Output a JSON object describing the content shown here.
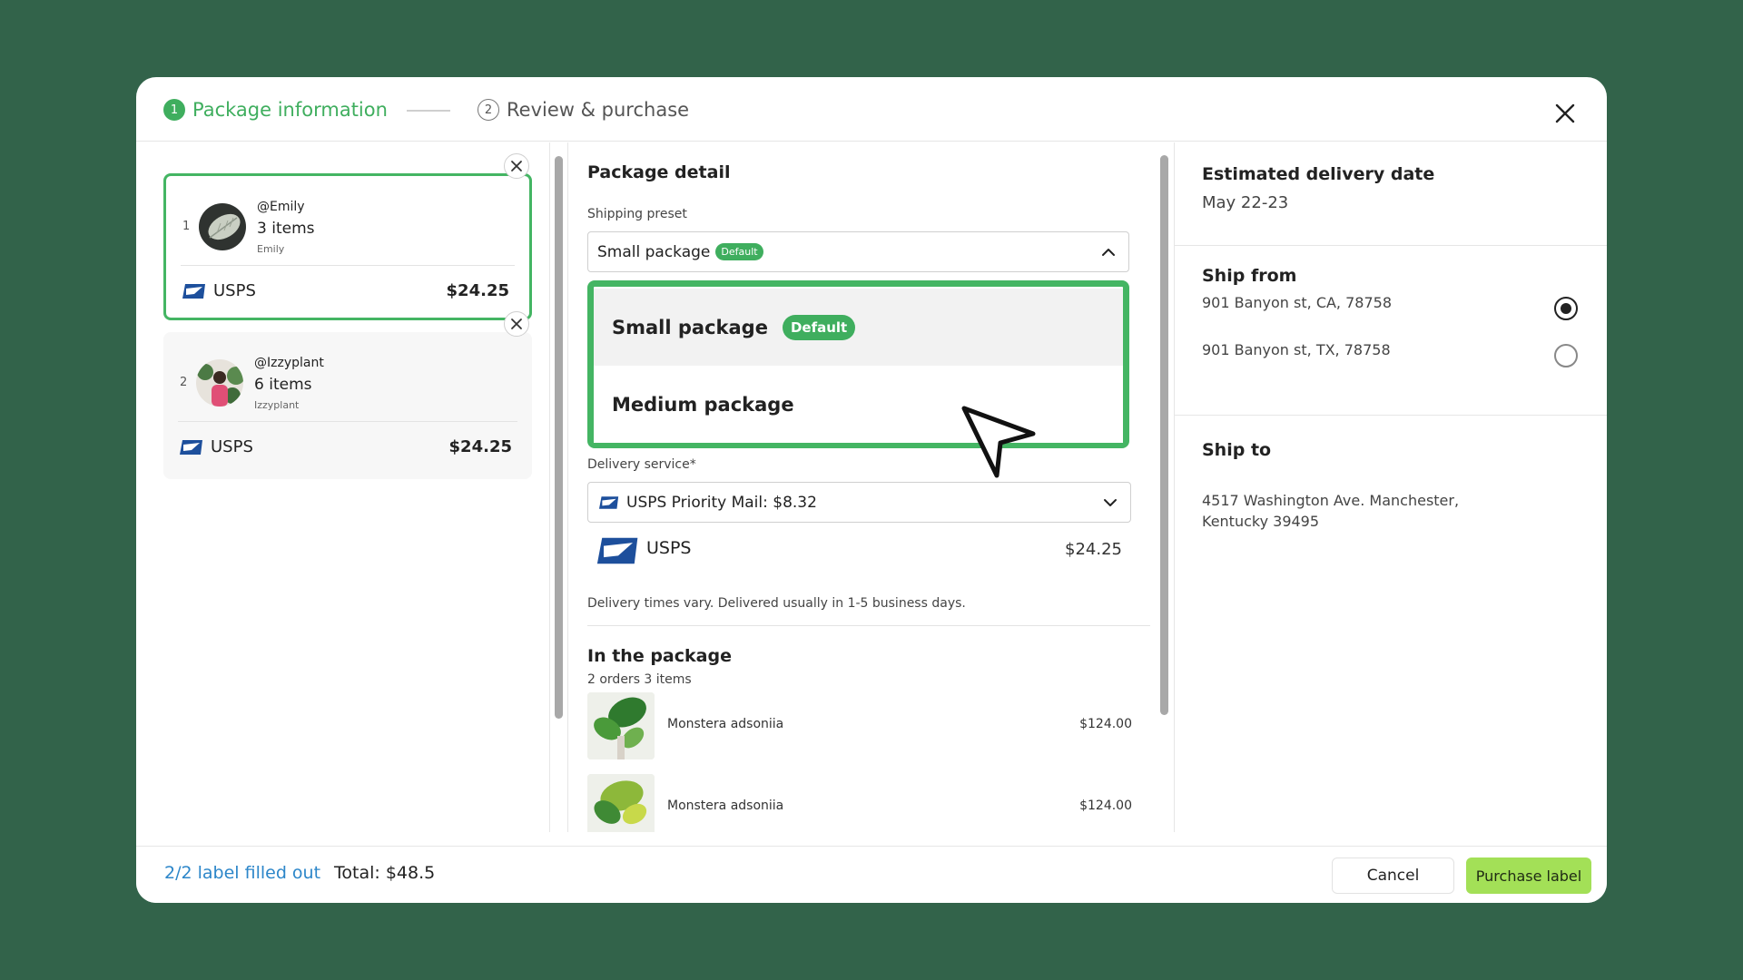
{
  "header": {
    "steps": [
      {
        "number": "1",
        "label": "Package information"
      },
      {
        "number": "2",
        "label": "Review & purchase"
      }
    ]
  },
  "packages": [
    {
      "index": "1",
      "user": "@Emily",
      "items": "3 items",
      "name": "Emily",
      "carrier": "USPS",
      "price": "$24.25",
      "selected": true
    },
    {
      "index": "2",
      "user": "@Izzyplant",
      "items": "6 items",
      "name": "Izzyplant",
      "carrier": "USPS",
      "price": "$24.25",
      "selected": false
    }
  ],
  "detail": {
    "title": "Package detail",
    "shipping_preset_label": "Shipping preset",
    "preset_value": "Small package",
    "preset_badge": "Default",
    "preset_options": [
      {
        "label": "Small package",
        "badge": "Default"
      },
      {
        "label": "Medium package",
        "badge": ""
      }
    ],
    "delivery_label": "Delivery service*",
    "delivery_value": "USPS Priority Mail: $8.32",
    "carrier_name": "USPS",
    "carrier_price": "$24.25",
    "delivery_note": "Delivery times vary. Delivered usually in 1-5 business days.",
    "in_package_title": "In the package",
    "in_package_sub": "2 orders 3 items",
    "products": [
      {
        "name": "Monstera adsoniia",
        "price": "$124.00"
      },
      {
        "name": "Monstera adsoniia",
        "price": "$124.00"
      }
    ]
  },
  "right": {
    "delivery_title": "Estimated delivery date",
    "delivery_date": "May 22-23",
    "ship_from_title": "Ship from",
    "ship_from_options": [
      {
        "address": "901 Banyon st, CA, 78758",
        "selected": true
      },
      {
        "address": "901 Banyon st, TX, 78758",
        "selected": false
      }
    ],
    "ship_to_title": "Ship to",
    "ship_to_line1": "4517 Washington Ave. Manchester,",
    "ship_to_line2": "Kentucky 39495"
  },
  "footer": {
    "filled_text": "2/2 label filled out",
    "total_text": "Total: $48.5",
    "cancel_label": "Cancel",
    "purchase_label": "Purchase label"
  },
  "colors": {
    "background": "#32634a",
    "accent_green": "#3fae5e",
    "purchase_button": "#a3e057",
    "link_blue": "#2c86c9"
  },
  "icons": [
    "close-icon",
    "chevron-up-icon",
    "chevron-down-icon",
    "usps-logo-icon",
    "cursor-pointer-icon"
  ]
}
